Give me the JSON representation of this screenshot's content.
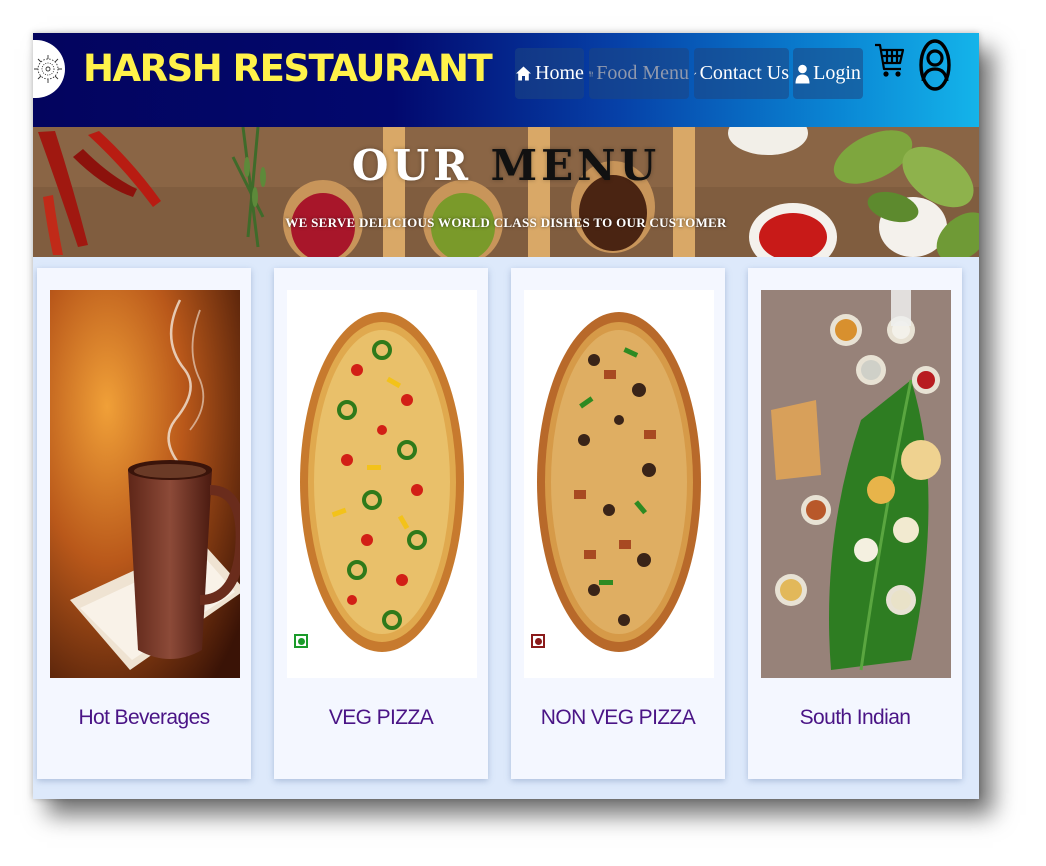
{
  "navbar": {
    "brand": "HARSH RESTAURANT",
    "items": [
      {
        "label": "Home",
        "icon": "home-icon",
        "active": false
      },
      {
        "label": "Food Menu",
        "icon": "utensils-icon",
        "active": true
      },
      {
        "label": "Contact Us",
        "icon": "pencil-icon",
        "active": false
      },
      {
        "label": "Login",
        "icon": "user-icon",
        "active": false
      }
    ],
    "cart_icon": "shopping-cart-icon",
    "profile_icon": "user-circle-icon"
  },
  "banner": {
    "title_part1": "OUR ",
    "title_part2": "MENU",
    "subtitle": "WE SERVE DELICIOUS WORLD CLASS DISHES TO OUR CUSTOMER"
  },
  "menu": [
    {
      "label": "Hot Beverages"
    },
    {
      "label": "VEG PIZZA",
      "badge": "veg"
    },
    {
      "label": "NON VEG PIZZA",
      "badge": "non-veg"
    },
    {
      "label": "South Indian"
    }
  ],
  "colors": {
    "brand": "#fff24a",
    "card_label": "#4a1486",
    "veg_badge": "#1a9b2a",
    "nonveg_badge": "#8b1a1a"
  }
}
